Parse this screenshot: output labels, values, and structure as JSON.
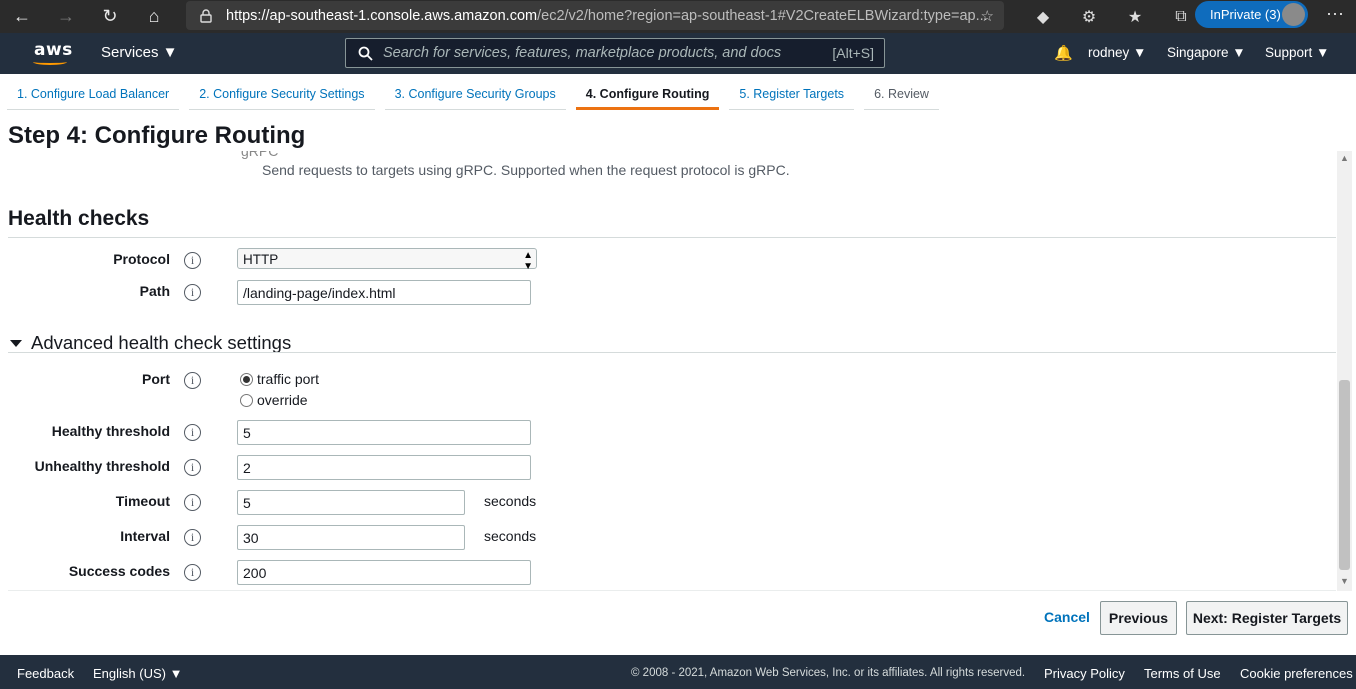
{
  "browser": {
    "url_host": "https://ap-southeast-1.console.aws.amazon.com",
    "url_rest": "/ec2/v2/home?region=ap-southeast-1#V2CreateELBWizard:type=ap...",
    "inprivate_label": "InPrivate (3)"
  },
  "aws_nav": {
    "logo": "aws",
    "services_label": "Services ▼",
    "search_placeholder": "Search for services, features, marketplace products, and docs",
    "search_hint": "[Alt+S]",
    "user": "rodney ▼",
    "region": "Singapore ▼",
    "support": "Support ▼"
  },
  "steps": [
    {
      "label": "1. Configure Load Balancer"
    },
    {
      "label": "2. Configure Security Settings"
    },
    {
      "label": "3. Configure Security Groups"
    },
    {
      "label": "4. Configure Routing"
    },
    {
      "label": "5. Register Targets"
    },
    {
      "label": "6. Review"
    }
  ],
  "page_title": "Step 4: Configure Routing",
  "grpc": {
    "fragment": "gRPC",
    "description": "Send requests to targets using gRPC. Supported when the request protocol is gRPC."
  },
  "health_checks": {
    "heading": "Health checks",
    "protocol_label": "Protocol",
    "protocol_value": "HTTP",
    "path_label": "Path",
    "path_value": "/landing-page/index.html"
  },
  "advanced": {
    "heading": "Advanced health check settings",
    "port_label": "Port",
    "port_option_traffic": "traffic port",
    "port_option_override": "override",
    "healthy_label": "Healthy threshold",
    "healthy_value": "5",
    "unhealthy_label": "Unhealthy threshold",
    "unhealthy_value": "2",
    "timeout_label": "Timeout",
    "timeout_value": "5",
    "timeout_unit": "seconds",
    "interval_label": "Interval",
    "interval_value": "30",
    "interval_unit": "seconds",
    "success_label": "Success codes",
    "success_value": "200"
  },
  "actions": {
    "cancel": "Cancel",
    "previous": "Previous",
    "next": "Next: Register Targets"
  },
  "footer": {
    "feedback": "Feedback",
    "language": "English (US) ▼",
    "copyright": "© 2008 - 2021, Amazon Web Services, Inc. or its affiliates. All rights reserved.",
    "privacy": "Privacy Policy",
    "terms": "Terms of Use",
    "cookies": "Cookie preferences"
  }
}
